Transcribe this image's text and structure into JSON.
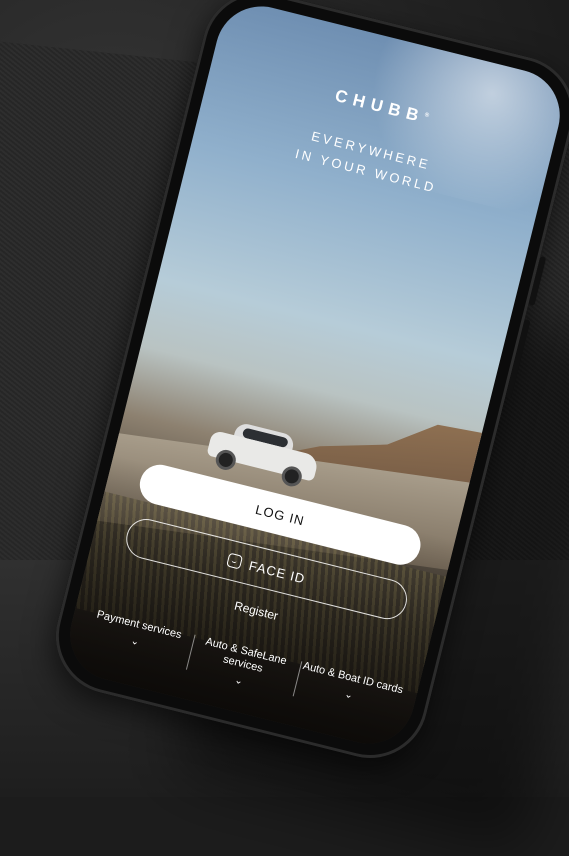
{
  "brand": {
    "logo_text": "CHUBB",
    "logo_mark": "®",
    "tagline_line1": "EVERYWHERE",
    "tagline_line2": "IN YOUR WORLD"
  },
  "actions": {
    "login_label": "LOG IN",
    "face_id_label": "FACE ID",
    "register_label": "Register"
  },
  "bottom_links": [
    {
      "label": "Payment services",
      "chevron": "⌄"
    },
    {
      "label": "Auto & SafeLane services",
      "chevron": "⌄"
    },
    {
      "label": "Auto & Boat ID cards",
      "chevron": "⌄"
    }
  ],
  "icons": {
    "face_id": "face-id-icon",
    "chevron": "chevron-down-icon"
  },
  "colors": {
    "button_bg": "#ffffff",
    "text": "#ffffff"
  }
}
